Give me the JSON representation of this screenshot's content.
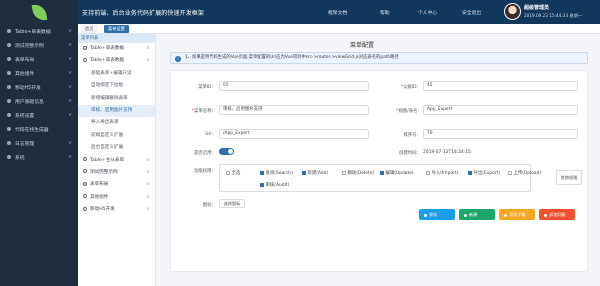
{
  "sidebar": {
    "items": [
      {
        "label": "Table+单表数据",
        "arrow": "∨"
      },
      {
        "label": "测试完整示例",
        "arrow": "∨"
      },
      {
        "label": "表单布局",
        "arrow": "∨"
      },
      {
        "label": "其他组件",
        "arrow": "∨"
      },
      {
        "label": "移动H5开发",
        "arrow": "∨"
      },
      {
        "label": "用户基础信息",
        "arrow": "∨"
      },
      {
        "label": "系统设置",
        "arrow": "∨"
      },
      {
        "label": "代码在线生成器",
        "arrow": ""
      },
      {
        "label": "日志管理",
        "arrow": "∨"
      },
      {
        "label": "系统",
        "arrow": "∨"
      }
    ]
  },
  "topbar": {
    "title": "支持前端、后台业务代码扩展的快速开发框架",
    "links": [
      "框架文档",
      "帮助",
      "个人中心",
      "安全退出"
    ],
    "user_name": "超级管理员",
    "user_time": "2019.09.23 15:44:33 星期一"
  },
  "tabs": [
    "首页",
    "菜单设置"
  ],
  "subnav": {
    "header": "菜单列表",
    "items": [
      {
        "label": "Table+单表数据",
        "level": 1,
        "arrow": "∧"
      },
      {
        "label": "Table+单表数据",
        "level": 1,
        "arrow": "∧"
      },
      {
        "label": "基础表单+编辑只读",
        "level": 2
      },
      {
        "label": "自动绑定下拉框",
        "level": 2
      },
      {
        "label": "新增编辑删除表单",
        "level": 2
      },
      {
        "label": "审核、启用图片支持",
        "level": 2,
        "active": true
      },
      {
        "label": "导入导出表单",
        "level": 2
      },
      {
        "label": "前端自定义扩展",
        "level": 2
      },
      {
        "label": "后台自定义扩展",
        "level": 2
      },
      {
        "label": "Table+主从表单",
        "level": 1,
        "arrow": "∨"
      },
      {
        "label": "测试完整示例",
        "level": 1,
        "arrow": "∨"
      },
      {
        "label": "表单布局",
        "level": 1,
        "arrow": "∨"
      },
      {
        "label": "其他组件",
        "level": 1,
        "arrow": "∨"
      },
      {
        "label": "移动H5开发",
        "level": 1,
        "arrow": "∨"
      }
    ]
  },
  "main": {
    "title": "菜单配置",
    "notice": "1、如果是用代码生成的Vue页面,菜单配置的Url应为Vue项目中src->router->viewGrid.js对应表名的path路径",
    "form": {
      "menu_id_label": "菜单ID:",
      "menu_id": "65",
      "parent_id_label": "父级ID:",
      "parent_id": "45",
      "menu_name_label": "菜单名称:",
      "menu_name": "审核、启用图片支持",
      "view_table_label": "视图/表名:",
      "view_table": "App_Expert",
      "url_label": "Url:",
      "url": "/App_Expert",
      "order_label": "排序号:",
      "order": "70",
      "enable_label": "是否启用:",
      "created_label": "创建时间:",
      "created": "2019-07-12T14:24:15",
      "perm_label": "功能权限:",
      "perms": [
        {
          "label": "全选",
          "checked": false
        },
        {
          "label": "查询(Search)",
          "checked": true
        },
        {
          "label": "新建(Add)",
          "checked": true
        },
        {
          "label": "删除(Delete)",
          "checked": false
        },
        {
          "label": "编辑(Update)",
          "checked": true
        },
        {
          "label": "导入(Import)",
          "checked": false
        },
        {
          "label": "导出(Export)",
          "checked": true
        },
        {
          "label": "上传(Upload)",
          "checked": false
        },
        {
          "label": "审核(Audit)",
          "checked": true
        }
      ],
      "other_perm": "其他权限",
      "icon_label": "图标:",
      "icon_button": "选择图标"
    },
    "buttons": [
      {
        "label": "保存",
        "color": "#1b9ee8"
      },
      {
        "label": "新建",
        "color": "#1aa76a"
      },
      {
        "label": "添加子级",
        "color": "#f5a623"
      },
      {
        "label": "添加同级",
        "color": "#f0522e"
      }
    ]
  },
  "colors": {
    "sidebar": "#202d3f",
    "topbar": "#11375a",
    "accent": "#2f6fa8"
  }
}
